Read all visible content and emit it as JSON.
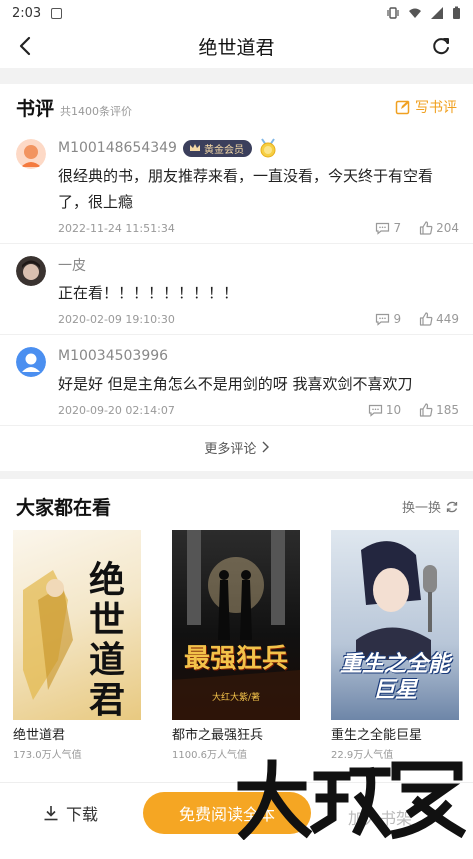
{
  "status_bar": {
    "time": "2:03"
  },
  "nav": {
    "title": "绝世道君"
  },
  "reviews": {
    "heading": "书评",
    "count_text": "共1400条评价",
    "write_label": "写书评",
    "items": [
      {
        "user": "M100148654349",
        "badge": "黄金会员",
        "text": "很经典的书，朋友推荐来看，一直没看，今天终于有空看了，很上瘾",
        "date": "2022-11-24 11:51:34",
        "comments": "7",
        "likes": "204"
      },
      {
        "user": "一皮",
        "text": "正在看！！！！！！！！！",
        "date": "2020-02-09 19:10:30",
        "comments": "9",
        "likes": "449"
      },
      {
        "user": "M10034503996",
        "text": "好是好 但是主角怎么不是用剑的呀 我喜欢剑不喜欢刀",
        "date": "2020-09-20 02:14:07",
        "comments": "10",
        "likes": "185"
      }
    ],
    "more_label": "更多评论"
  },
  "popular": {
    "heading": "大家都在看",
    "swap_label": "换一换",
    "books": [
      {
        "title": "绝世道君",
        "popularity": "173.0万人气值",
        "cover_text": "绝世道君",
        "cover_author": ""
      },
      {
        "title": "都市之最强狂兵",
        "popularity": "1100.6万人气值",
        "cover_text": "最强狂兵",
        "cover_author": "大红大紫/著"
      },
      {
        "title": "重生之全能巨星",
        "popularity": "22.9万人气值",
        "cover_text": "重生之全能巨星",
        "cover_author": ""
      }
    ]
  },
  "bottom": {
    "download_label": "下载",
    "read_label": "免费阅读全本",
    "shelf_label": "加入书架"
  },
  "watermark": "大玩家",
  "colors": {
    "accent": "#f5a623",
    "vip_bg": "#3b3f5c"
  }
}
